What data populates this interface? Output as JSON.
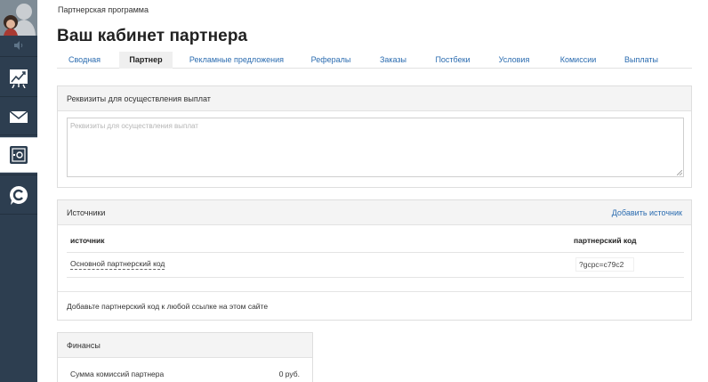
{
  "sidebar": {
    "items": [
      {
        "icon": "chart-icon"
      },
      {
        "icon": "mail-icon"
      },
      {
        "icon": "safe-icon"
      },
      {
        "icon": "chat-c-icon"
      }
    ],
    "active_index": 2
  },
  "breadcrumb": "Партнерская программа",
  "title": "Ваш кабинет партнера",
  "tabs": [
    {
      "label": "Сводная"
    },
    {
      "label": "Партнер"
    },
    {
      "label": "Рекламные предложения"
    },
    {
      "label": "Рефералы"
    },
    {
      "label": "Заказы"
    },
    {
      "label": "Постбеки"
    },
    {
      "label": "Условия"
    },
    {
      "label": "Комиссии"
    },
    {
      "label": "Выплаты"
    }
  ],
  "payment_details": {
    "header": "Реквизиты для осуществления выплат",
    "placeholder": "Реквизиты для осуществления выплат",
    "value": ""
  },
  "sources": {
    "header": "Источники",
    "add_link": "Добавить источник",
    "columns": {
      "source": "источник",
      "code": "партнерский код"
    },
    "rows": [
      {
        "source": "Основной партнерский код",
        "code": "?gcpc=c79c2"
      }
    ],
    "footer_text": "Добавьте партнерский код к любой ссылке на этом сайте"
  },
  "finances": {
    "header": "Финансы",
    "rows": [
      {
        "label": "Сумма комиссий партнера",
        "value": "0 руб."
      }
    ]
  },
  "colors": {
    "sidebar_bg": "#2d3e50",
    "link": "#2b6cb0",
    "panel_head_bg": "#f4f4f4"
  }
}
